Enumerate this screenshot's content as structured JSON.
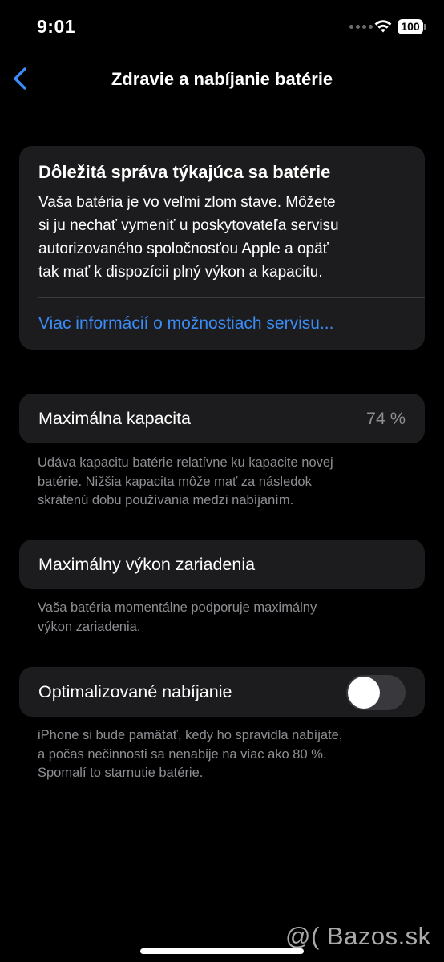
{
  "status_bar": {
    "time": "9:01",
    "battery_level": "100",
    "icons": [
      "cellular-dots-icon",
      "wifi-icon",
      "battery-icon"
    ]
  },
  "nav": {
    "back_icon": "chevron-left-icon",
    "title": "Zdravie a nabíjanie batérie"
  },
  "alert": {
    "title": "Dôležitá správa týkajúca sa batérie",
    "lines": [
      "Vaša batéria je vo veľmi zlom stave. Môžete",
      "si ju nechať vymeniť u poskytovateľa servisu",
      "autorizovaného spoločnosťou Apple a opäť",
      "tak mať k dispozícii plný výkon a kapacitu."
    ],
    "link": "Viac informácií o možnostiach servisu..."
  },
  "max_capacity": {
    "label": "Maximálna kapacita",
    "value": "74 %",
    "footnote_lines": [
      "Udáva kapacitu batérie relatívne ku kapacite novej",
      "batérie. Nižšia kapacita môže mať za následok",
      "skrátenú dobu používania medzi nabíjaním."
    ]
  },
  "peak_performance": {
    "label": "Maximálny výkon zariadenia",
    "footnote_lines": [
      "Vaša batéria momentálne podporuje maximálny",
      "výkon zariadenia."
    ]
  },
  "optimized_charging": {
    "label": "Optimalizované nabíjanie",
    "enabled": false,
    "footnote_lines": [
      "iPhone si bude pamätať, kedy ho spravidla nabíjate,",
      "a počas nečinnosti sa nenabije na viac ako 80 %.",
      "Spomalí to starnutie batérie."
    ]
  },
  "watermark": "@( Bazos.sk",
  "colors": {
    "background": "#000000",
    "card": "#1c1c1e",
    "accent": "#3b8cf6",
    "secondary_text": "#8e8e93",
    "toggle_off": "#39393d"
  }
}
